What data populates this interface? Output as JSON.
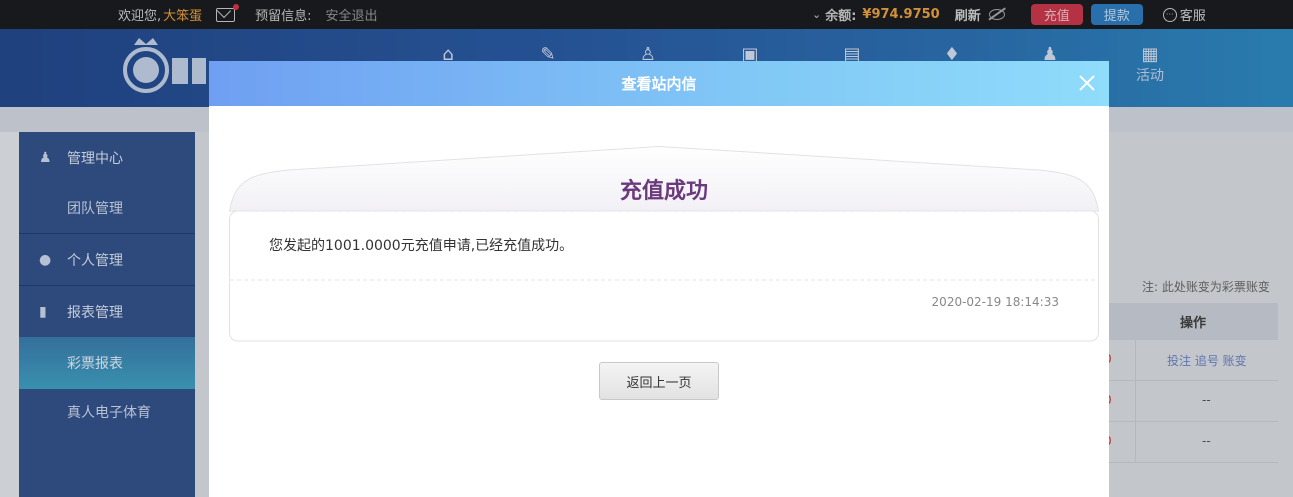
{
  "topbar": {
    "welcome": "欢迎您,",
    "username": "大笨蛋",
    "reserve_info": "预留信息:",
    "logout": "安全退出",
    "balance_label": "余额:",
    "balance_value": "¥974.9750",
    "refresh": "刷新",
    "recharge": "充值",
    "withdraw": "提款",
    "customer_service": "客服"
  },
  "header": {
    "nav_visible_label": "活动"
  },
  "sidebar": {
    "items": [
      {
        "label": "管理中心",
        "icon": "users-icon"
      },
      {
        "label": "团队管理"
      },
      {
        "label": "个人管理",
        "icon": "user-icon"
      },
      {
        "label": "报表管理",
        "icon": "report-icon"
      },
      {
        "label": "彩票报表"
      },
      {
        "label": "真人电子体育"
      }
    ]
  },
  "background_table": {
    "note": "注: 此处账变为彩票账变",
    "header_op": "操作",
    "rows": [
      {
        "op": "投注 追号 账变"
      },
      {
        "op": "--"
      },
      {
        "op": "--"
      }
    ]
  },
  "modal": {
    "title": "查看站内信",
    "message_title": "充值成功",
    "message_body": "您发起的1001.0000元充值申请,已经充值成功。",
    "message_time": "2020-02-19 18:14:33",
    "back_button": "返回上一页"
  },
  "colors": {
    "accent_gold": "#f0a640",
    "recharge_red": "#cd3a4e",
    "withdraw_blue": "#2f7fc4",
    "message_title_purple": "#6b3a7e"
  }
}
